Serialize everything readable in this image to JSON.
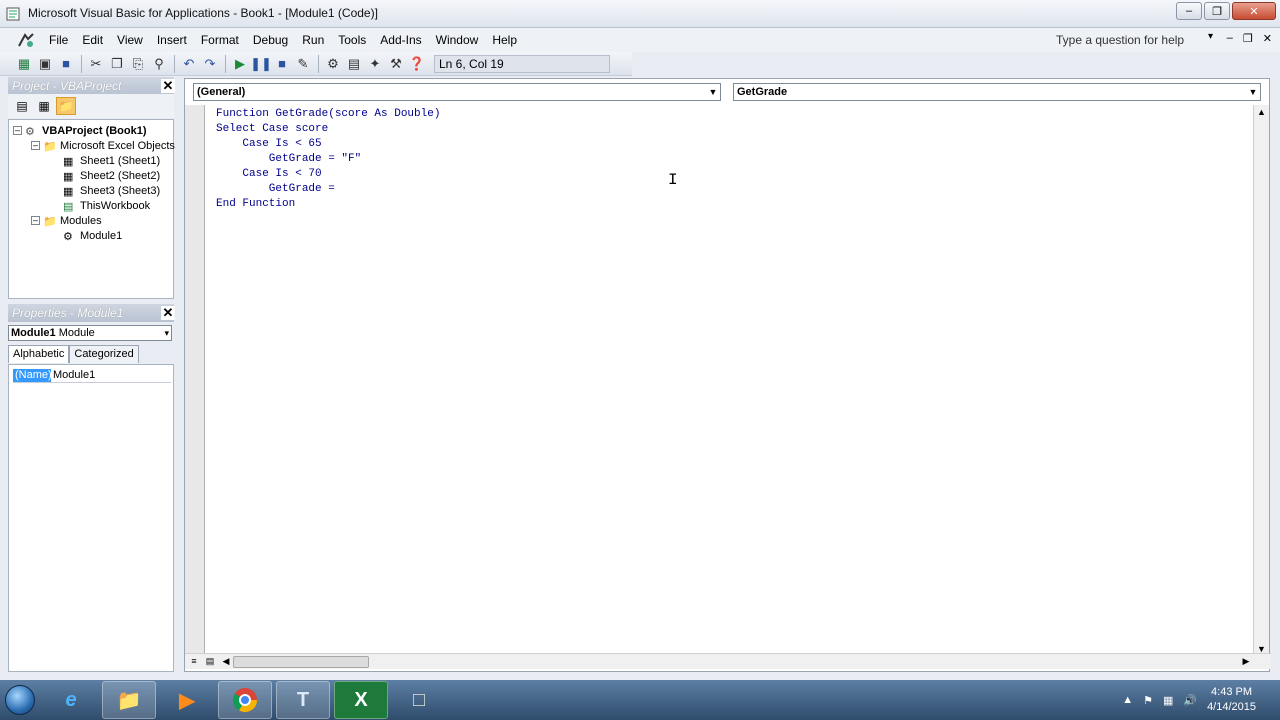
{
  "window": {
    "title": "Microsoft Visual Basic for Applications - Book1 - [Module1 (Code)]"
  },
  "menubar": {
    "items": [
      {
        "label": "File",
        "key": "F"
      },
      {
        "label": "Edit",
        "key": "E"
      },
      {
        "label": "View",
        "key": "V"
      },
      {
        "label": "Insert",
        "key": "I"
      },
      {
        "label": "Format",
        "key": "o"
      },
      {
        "label": "Debug",
        "key": "D"
      },
      {
        "label": "Run",
        "key": "R"
      },
      {
        "label": "Tools",
        "key": "T"
      },
      {
        "label": "Add-Ins",
        "key": "A"
      },
      {
        "label": "Window",
        "key": "W"
      },
      {
        "label": "Help",
        "key": "H"
      }
    ],
    "help_placeholder": "Type a question for help"
  },
  "toolbar": {
    "position": "Ln 6, Col 19"
  },
  "project_pane": {
    "title": "Project - VBAProject",
    "tree": [
      {
        "label": "VBAProject (Book1)",
        "level": 0
      },
      {
        "label": "Microsoft Excel Objects",
        "level": 1
      },
      {
        "label": "Sheet1 (Sheet1)",
        "level": 2
      },
      {
        "label": "Sheet2 (Sheet2)",
        "level": 2
      },
      {
        "label": "Sheet3 (Sheet3)",
        "level": 2
      },
      {
        "label": "ThisWorkbook",
        "level": 2
      },
      {
        "label": "Modules",
        "level": 1
      },
      {
        "label": "Module1",
        "level": 2
      }
    ]
  },
  "properties_pane": {
    "title": "Properties - Module1",
    "object_name": "Module1",
    "object_type": "Module",
    "tabs": [
      "Alphabetic",
      "Categorized"
    ],
    "rows": [
      {
        "name": "(Name)",
        "value": "Module1"
      }
    ]
  },
  "code_window": {
    "object_combo": "(General)",
    "procedure_combo": "GetGrade",
    "lines": [
      "Function GetGrade(score As Double)",
      "Select Case score",
      "    Case Is < 65",
      "        GetGrade = \"F\"",
      "    Case Is < 70",
      "        GetGrade =",
      "End Function"
    ]
  },
  "taskbar": {
    "clock_time": "4:43 PM",
    "clock_date": "4/14/2015"
  },
  "colors": {
    "code_text": "#00008b",
    "selection": "#3399ff",
    "taskbar": "#3b5a7d"
  }
}
